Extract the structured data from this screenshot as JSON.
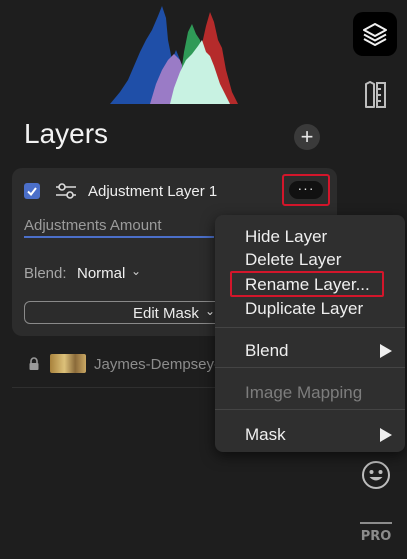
{
  "panel": {
    "title": "Layers",
    "add_label": "+"
  },
  "layer": {
    "name": "Adjustment Layer 1",
    "checked": true,
    "more_label": "···",
    "amount_label": "Adjustments Amount",
    "blend_label": "Blend:",
    "blend_value": "Normal",
    "edit_mask_label": "Edit Mask"
  },
  "image_layer": {
    "name": "Jaymes-Dempsey-P"
  },
  "context_menu": {
    "items": [
      "Hide Layer",
      "Delete Layer",
      "Rename Layer...",
      "Duplicate Layer"
    ],
    "blend": "Blend",
    "image_mapping": "Image Mapping",
    "mask": "Mask"
  },
  "toolbar": {
    "pro_label": "PRO"
  },
  "icons": [
    "layers-icon",
    "tools-icon",
    "smiley-icon",
    "pro-icon",
    "lock-icon",
    "adjustments-icon",
    "chevron-down-icon",
    "submenu-arrow-icon"
  ],
  "colors": {
    "background": "#1e1e1e",
    "accent": "#4b6fc9",
    "highlight": "#d3162b",
    "histogram": [
      "#1f4fa8",
      "#9a7bc6",
      "#2f9a57",
      "#b52b2b",
      "#c8f2e2"
    ]
  }
}
